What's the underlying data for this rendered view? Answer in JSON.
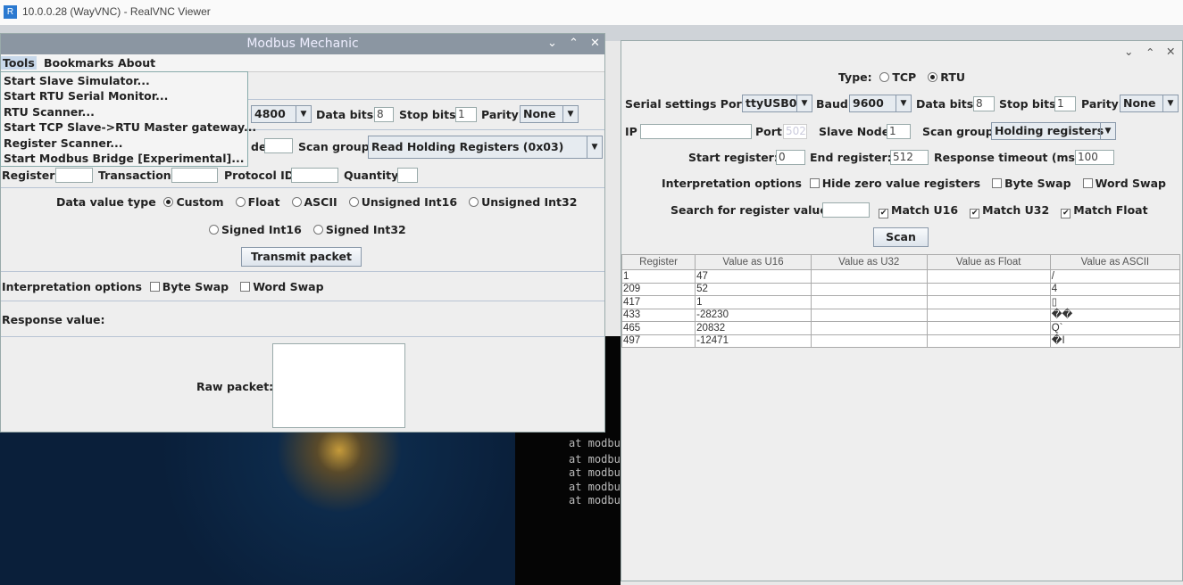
{
  "vnc": {
    "title": "10.0.0.28 (WayVNC) - RealVNC Viewer"
  },
  "left": {
    "title": "Modbus Mechanic",
    "menu": [
      "Tools",
      "Bookmarks",
      "About"
    ],
    "tools_items": [
      "Start Slave Simulator...",
      "Start RTU Serial Monitor...",
      "RTU Scanner...",
      "Start TCP Slave->RTU Master gateway...",
      "Register Scanner...",
      "Start Modbus Bridge [Experimental]..."
    ],
    "baud": "4800",
    "data_bits_label": "Data bits",
    "data_bits": "8",
    "stop_bits_label": "Stop bits",
    "stop_bits": "1",
    "parity_label": "Parity",
    "parity": "None",
    "node_label_partial": "de",
    "scan_group_label": "Scan group",
    "scan_group": "Read Holding Registers (0x03)",
    "register_label": "Register",
    "transaction_label": "Transaction",
    "protocol_label": "Protocol ID",
    "quantity_label": "Quantity",
    "data_type_label": "Data value type",
    "data_types": [
      "Custom",
      "Float",
      "ASCII",
      "Unsigned Int16",
      "Unsigned Int32",
      "Signed Int16",
      "Signed Int32"
    ],
    "data_type_selected": "Custom",
    "transmit": "Transmit packet",
    "interp_label": "Interpretation options",
    "byte_swap": "Byte Swap",
    "word_swap": "Word Swap",
    "response_label": "Response value:",
    "raw_label": "Raw packet:"
  },
  "terminal": {
    "lines": [
      "at modbu",
      "at modbu",
      "at modbu",
      "at modbu",
      "at modbu"
    ]
  },
  "right": {
    "type_label": "Type:",
    "type_tcp": "TCP",
    "type_rtu": "RTU",
    "type_selected": "RTU",
    "serial_label": "Serial settings Port",
    "port": "ttyUSB0",
    "baud_label": "Baud",
    "baud": "9600",
    "data_bits_label": "Data bits",
    "data_bits": "8",
    "stop_bits_label": "Stop bits",
    "stop_bits": "1",
    "parity_label": "Parity",
    "parity": "None",
    "ip_label": "IP",
    "ip": "",
    "port_label": "Port",
    "tcp_port": "502",
    "slave_label": "Slave Node",
    "slave": "1",
    "scan_group_label": "Scan group",
    "scan_group": "Holding registers",
    "start_label": "Start register:",
    "start": "0",
    "end_label": "End register:",
    "end": "512",
    "timeout_label": "Response timeout (ms):",
    "timeout": "100",
    "interp_label": "Interpretation options",
    "hide_zero": "Hide zero value registers",
    "byte_swap": "Byte Swap",
    "word_swap": "Word Swap",
    "search_label": "Search for register value:",
    "match_u16": "Match U16",
    "match_u32": "Match U32",
    "match_float": "Match Float",
    "scan": "Scan",
    "columns": [
      "Register",
      "Value as U16",
      "Value as U32",
      "Value as Float",
      "Value as ASCII"
    ],
    "rows": [
      [
        "1",
        "47",
        "",
        "",
        "/"
      ],
      [
        "209",
        "52",
        "",
        "",
        "4"
      ],
      [
        "417",
        "1",
        "",
        "",
        "▯"
      ],
      [
        "433",
        "-28230",
        "",
        "",
        "��"
      ],
      [
        "465",
        "20832",
        "",
        "",
        "Q`"
      ],
      [
        "497",
        "-12471",
        "",
        "",
        "�I"
      ]
    ]
  }
}
